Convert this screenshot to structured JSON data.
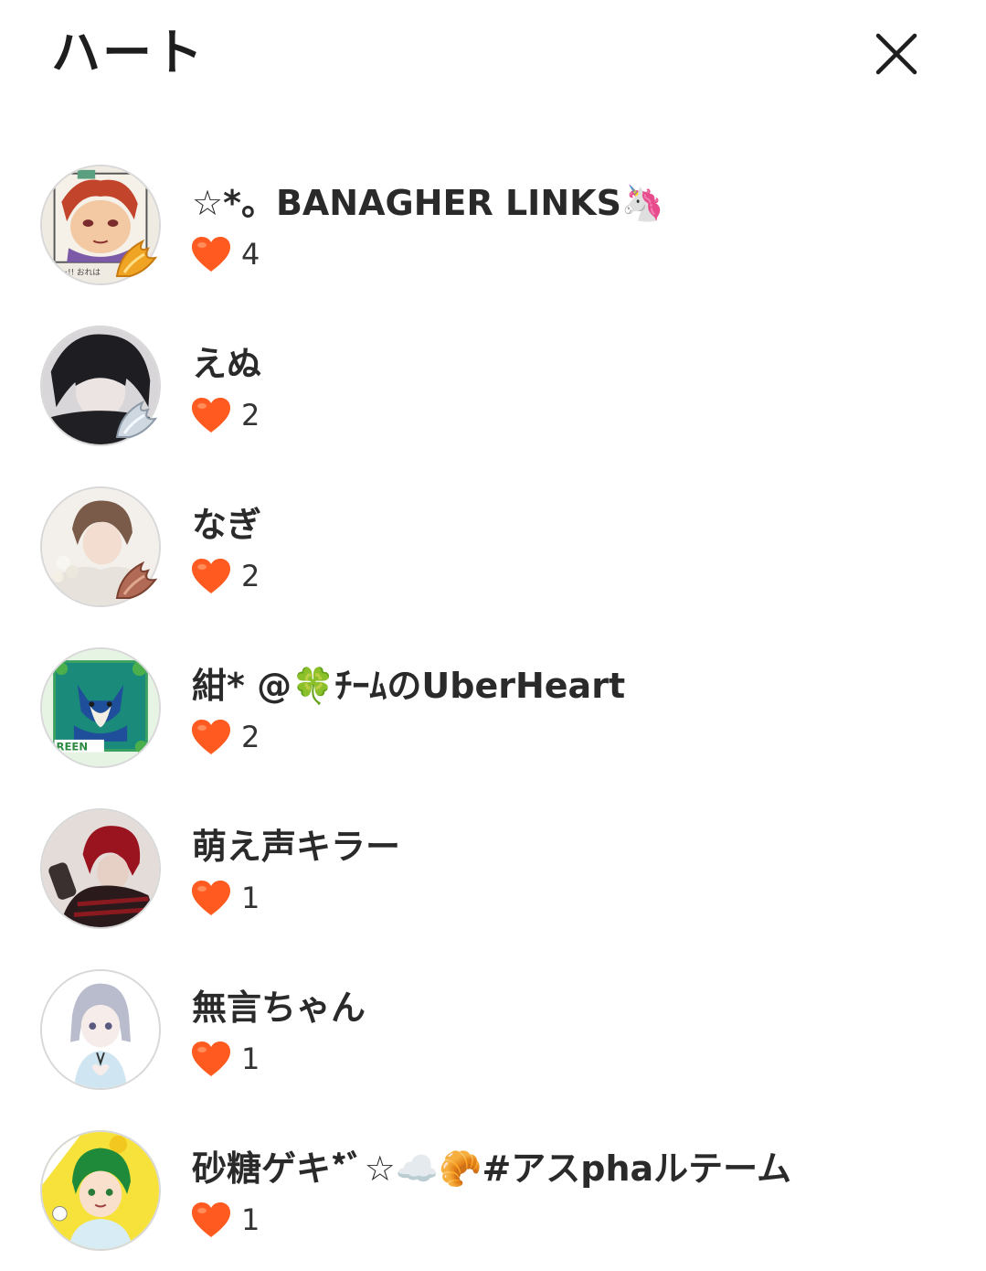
{
  "header": {
    "title": "ハート"
  },
  "colors": {
    "heart": "#ff5a1f",
    "heart_highlight": "#ff8a50",
    "text": "#2a2a2a",
    "avatar_border": "#d8d8d8"
  },
  "users": [
    {
      "name": "☆*。BANAGHER LINKS🦄",
      "count": "4",
      "avatar_icon": "drawn-character-avatar",
      "badge_icon": "gold-wing-badge-icon"
    },
    {
      "name": "えぬ",
      "count": "2",
      "avatar_icon": "dark-hair-character-avatar",
      "badge_icon": "silver-wing-badge-icon"
    },
    {
      "name": "なぎ",
      "count": "2",
      "avatar_icon": "brown-hair-character-avatar",
      "badge_icon": "bronze-wing-badge-icon"
    },
    {
      "name": "紺* @🍀ﾁｰﾑのUberHeart",
      "count": "2",
      "avatar_icon": "green-fox-avatar",
      "badge_icon": ""
    },
    {
      "name": "萌え声キラー",
      "count": "1",
      "avatar_icon": "red-hair-photo-avatar",
      "badge_icon": ""
    },
    {
      "name": "無言ちゃん",
      "count": "1",
      "avatar_icon": "silver-hair-girl-avatar",
      "badge_icon": ""
    },
    {
      "name": "砂糖ゲキ*ﾞ☆☁️🥐#アスphaルテーム",
      "count": "1",
      "avatar_icon": "green-hair-boy-avatar",
      "badge_icon": ""
    }
  ]
}
